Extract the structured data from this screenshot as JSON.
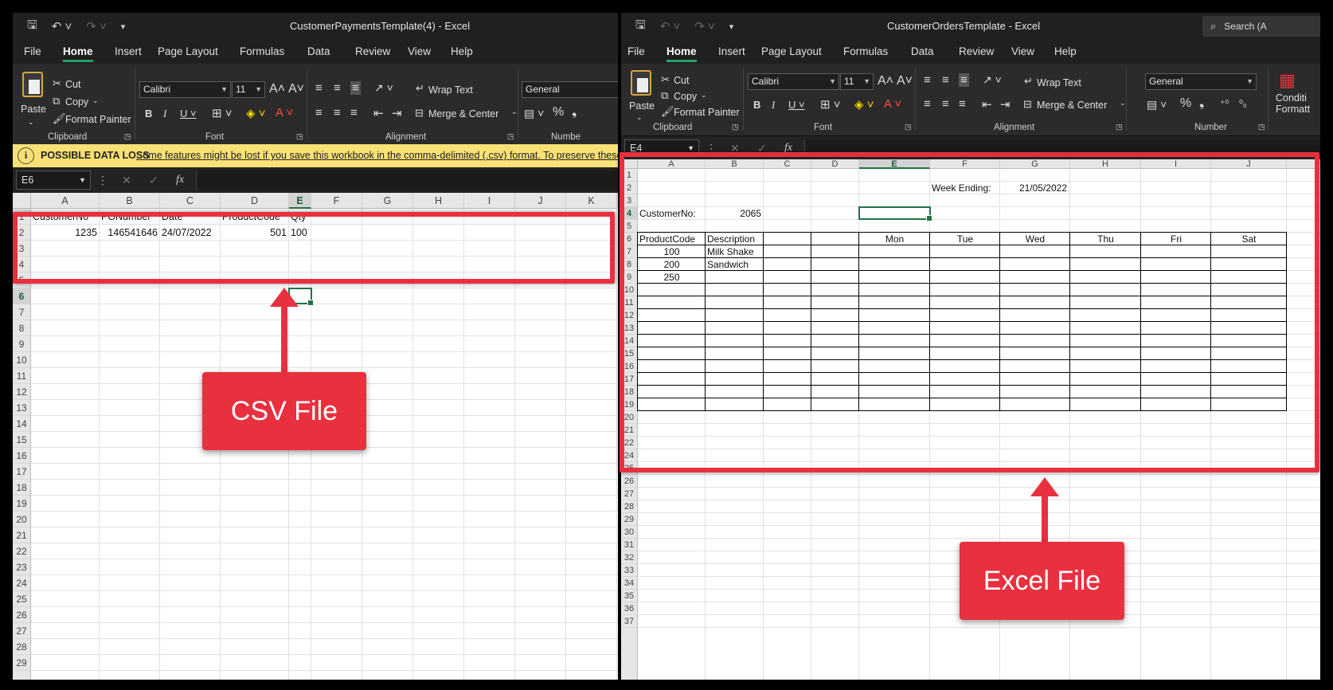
{
  "left_window": {
    "title": "CustomerPaymentsTemplate(4)  -  Excel",
    "menu": [
      "File",
      "Home",
      "Insert",
      "Page Layout",
      "Formulas",
      "Data",
      "Review",
      "View",
      "Help"
    ],
    "ribbon": {
      "paste": "Paste",
      "cut": "Cut",
      "copy": "Copy",
      "format_painter": "Format Painter",
      "font_name": "Calibri",
      "font_size": "11",
      "wrap_text": "Wrap Text",
      "merge_center": "Merge & Center",
      "number_format": "General",
      "groups": {
        "clipboard": "Clipboard",
        "font": "Font",
        "alignment": "Alignment",
        "number": "Numbe"
      }
    },
    "message_bar": {
      "title": "POSSIBLE DATA LOSS",
      "text": "Some features might be lost if you save this workbook in the comma-delimited (.csv) format. To preserve these fe"
    },
    "name_box": "E6",
    "columns": [
      "A",
      "B",
      "C",
      "D",
      "E",
      "F",
      "G",
      "H",
      "I",
      "J",
      "K"
    ],
    "rows": [
      "1",
      "2",
      "3",
      "4",
      "5",
      "6",
      "7",
      "8",
      "9",
      "10",
      "11",
      "12",
      "13",
      "14",
      "15",
      "16",
      "17",
      "18",
      "19",
      "20",
      "21",
      "22",
      "23",
      "24",
      "25",
      "26",
      "27",
      "28",
      "29"
    ],
    "headers": {
      "a": "CustomerNo",
      "b": "PONumber",
      "c": "Date",
      "d": "ProductCode",
      "e": "Qty"
    },
    "values": {
      "a": "1235",
      "b": "146541646",
      "c": "24/07/2022",
      "d": "501",
      "e": "100"
    },
    "callout": "CSV File"
  },
  "right_window": {
    "title": "CustomerOrdersTemplate  -  Excel",
    "search": "Search (A",
    "menu": [
      "File",
      "Home",
      "Insert",
      "Page Layout",
      "Formulas",
      "Data",
      "Review",
      "View",
      "Help"
    ],
    "ribbon": {
      "paste": "Paste",
      "cut": "Cut",
      "copy": "Copy",
      "format_painter": "Format Painter",
      "font_name": "Calibri",
      "font_size": "11",
      "wrap_text": "Wrap Text",
      "merge_center": "Merge & Center",
      "number_format": "General",
      "conditional": "Conditi",
      "conditional2": "Formatt",
      "groups": {
        "clipboard": "Clipboard",
        "font": "Font",
        "alignment": "Alignment",
        "number": "Number"
      }
    },
    "name_box": "E4",
    "columns": [
      "A",
      "B",
      "C",
      "D",
      "E",
      "F",
      "G",
      "H",
      "I",
      "J"
    ],
    "rows": [
      "1",
      "2",
      "3",
      "4",
      "5",
      "6",
      "7",
      "8",
      "9",
      "10",
      "11",
      "12",
      "13",
      "14",
      "15",
      "16",
      "17",
      "18",
      "19",
      "20",
      "21",
      "22",
      "24",
      "25",
      "26",
      "27",
      "28",
      "29",
      "30",
      "31",
      "32",
      "33",
      "34",
      "35",
      "36",
      "37"
    ],
    "week_ending_label": "Week Ending:",
    "week_ending_value": "21/05/2022",
    "customer_label": "CustomerNo:",
    "customer_value": "2065",
    "table_headers": {
      "a": "ProductCode",
      "b": "Description",
      "e": "Mon",
      "f": "Tue",
      "g": "Wed",
      "h": "Thu",
      "i": "Fri",
      "j": "Sat"
    },
    "products": [
      {
        "code": "100",
        "desc": "Milk Shake"
      },
      {
        "code": "200",
        "desc": "Sandwich"
      },
      {
        "code": "250",
        "desc": ""
      }
    ],
    "callout": "Excel File"
  }
}
